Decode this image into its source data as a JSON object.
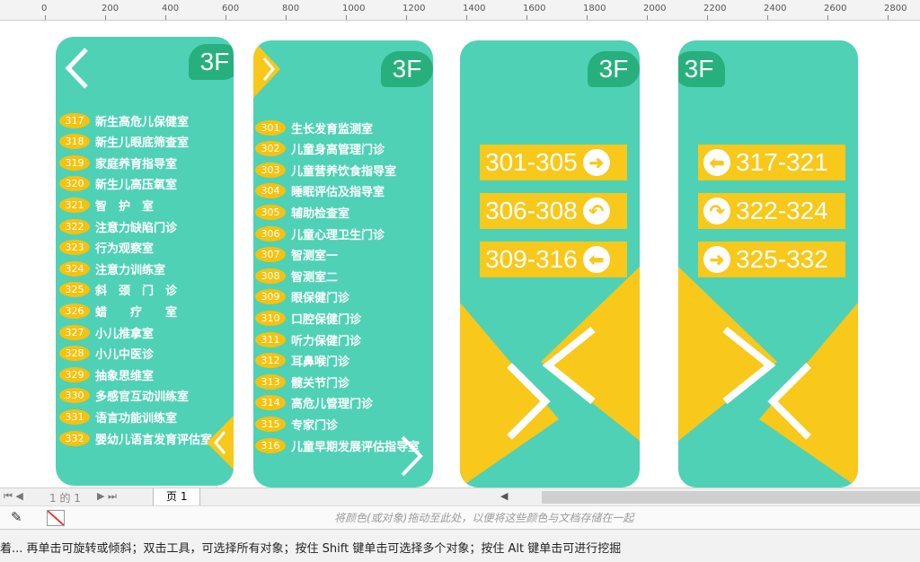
{
  "ruler": {
    "ticks": [
      "0",
      "200",
      "400",
      "600",
      "800",
      "1000",
      "1200",
      "1400",
      "1600",
      "1800",
      "2000",
      "2200",
      "2400",
      "2600",
      "2800"
    ]
  },
  "floor_label": "3F",
  "panel1": {
    "rooms": [
      {
        "num": "317",
        "name": "新生高危儿保健室"
      },
      {
        "num": "318",
        "name": "新生儿眼底筛查室"
      },
      {
        "num": "319",
        "name": "家庭养育指导室"
      },
      {
        "num": "320",
        "name": "新生儿高压氧室"
      },
      {
        "num": "321",
        "name": "智　护　室"
      },
      {
        "num": "322",
        "name": "注意力缺陷门诊"
      },
      {
        "num": "323",
        "name": "行为观察室"
      },
      {
        "num": "324",
        "name": "注意力训练室"
      },
      {
        "num": "325",
        "name": "斜　颈　门　诊"
      },
      {
        "num": "326",
        "name": "蜡　　疗　　室"
      },
      {
        "num": "327",
        "name": "小儿推拿室"
      },
      {
        "num": "328",
        "name": "小儿中医诊"
      },
      {
        "num": "329",
        "name": "抽象思维室"
      },
      {
        "num": "330",
        "name": "多感官互动训练室"
      },
      {
        "num": "331",
        "name": "语言功能训练室"
      },
      {
        "num": "332",
        "name": "婴幼儿语言发育评估室"
      }
    ]
  },
  "panel2": {
    "rooms": [
      {
        "num": "301",
        "name": "生长发育监测室"
      },
      {
        "num": "302",
        "name": "儿童身高管理门诊"
      },
      {
        "num": "303",
        "name": "儿童营养饮食指导室"
      },
      {
        "num": "304",
        "name": "睡眠评估及指导室"
      },
      {
        "num": "305",
        "name": "辅助检查室"
      },
      {
        "num": "306",
        "name": "儿童心理卫生门诊"
      },
      {
        "num": "307",
        "name": "智测室一"
      },
      {
        "num": "308",
        "name": "智测室二"
      },
      {
        "num": "309",
        "name": "眼保健门诊"
      },
      {
        "num": "310",
        "name": "口腔保健门诊"
      },
      {
        "num": "311",
        "name": "听力保健门诊"
      },
      {
        "num": "312",
        "name": "耳鼻喉门诊"
      },
      {
        "num": "313",
        "name": "髋关节门诊"
      },
      {
        "num": "314",
        "name": "高危儿管理门诊"
      },
      {
        "num": "315",
        "name": "专家门诊"
      },
      {
        "num": "316",
        "name": "儿童早期发展评估指导室"
      }
    ]
  },
  "panel3": {
    "ranges": [
      {
        "text": "301-305",
        "icon": "arrow-right-icon"
      },
      {
        "text": "306-308",
        "icon": "turn-back-icon"
      },
      {
        "text": "309-316",
        "icon": "arrow-left-icon"
      }
    ]
  },
  "panel4": {
    "ranges": [
      {
        "text": "317-321",
        "icon": "arrow-left-icon"
      },
      {
        "text": "322-324",
        "icon": "turn-right-icon"
      },
      {
        "text": "325-332",
        "icon": "arrow-right-icon"
      }
    ]
  },
  "pagebar": {
    "page_info": "1 的 1",
    "page_tab": "页 1"
  },
  "tray": {
    "hint": "将颜色(或对象)拖动至此处，以便将这些颜色与文档存储在一起"
  },
  "status": {
    "text": "着... 再单击可旋转或倾斜；双击工具，可选择所有对象；按住 Shift 键单击可选择多个对象；按住 Alt 键单击可进行挖掘"
  },
  "colors": {
    "teal": "#4fd1b5",
    "yellow": "#f8c81a",
    "green": "#27b07d"
  }
}
